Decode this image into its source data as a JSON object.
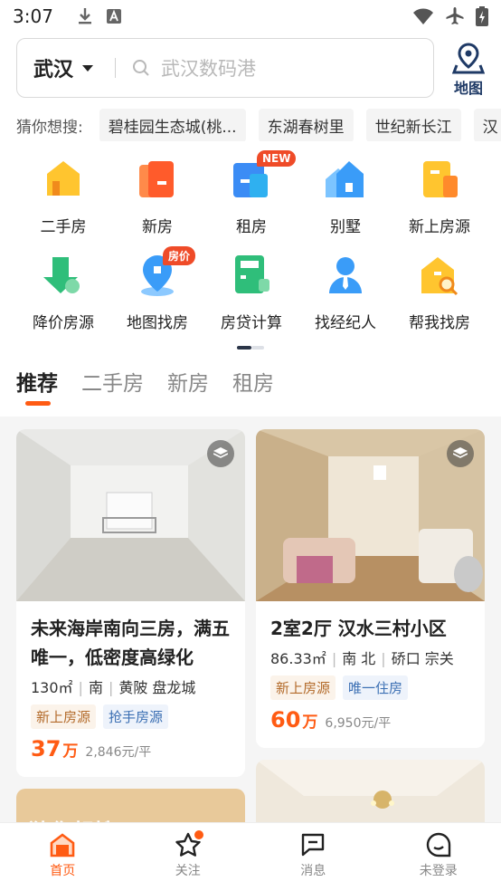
{
  "status_bar": {
    "time": "3:07"
  },
  "search": {
    "city": "武汉",
    "placeholder": "武汉数码港",
    "map_label": "地图"
  },
  "guess": {
    "title": "猜你想搜:",
    "chips": [
      "碧桂园生态城(桃...",
      "东湖春树里",
      "世纪新长江",
      "汉"
    ]
  },
  "grid": [
    [
      {
        "label": "二手房",
        "icon": "second-hand-house-icon",
        "color": "#ffc52f"
      },
      {
        "label": "新房",
        "icon": "new-house-icon",
        "color": "#ff6a3d"
      },
      {
        "label": "租房",
        "icon": "rent-house-icon",
        "color": "#3b8cf5",
        "badge": "NEW"
      },
      {
        "label": "别墅",
        "icon": "villa-icon",
        "color": "#3a9cf8"
      },
      {
        "label": "新上房源",
        "icon": "new-listing-icon",
        "color": "#ffc52f"
      }
    ],
    [
      {
        "label": "降价房源",
        "icon": "price-drop-icon",
        "color": "#2fbe7a"
      },
      {
        "label": "地图找房",
        "icon": "map-search-icon",
        "color": "#3a9cf8",
        "badge": "房价"
      },
      {
        "label": "房贷计算",
        "icon": "mortgage-calculator-icon",
        "color": "#2fbe7a"
      },
      {
        "label": "找经纪人",
        "icon": "agent-icon",
        "color": "#3a9cf8"
      },
      {
        "label": "帮我找房",
        "icon": "help-find-house-icon",
        "color": "#ffc52f"
      }
    ]
  ],
  "tabs": [
    "推荐",
    "二手房",
    "新房",
    "租房"
  ],
  "listings": [
    {
      "title": "未来海岸南向三房，满五唯一，低密度高绿化",
      "area": "130㎡",
      "direction": "南",
      "district": "黄陂 盘龙城",
      "tags": [
        "新上房源",
        "抢手房源"
      ],
      "price": "37",
      "unit": "万",
      "unit_price": "2,846元/平"
    },
    {
      "title": "2室2厅 汉水三村小区",
      "area": "86.33㎡",
      "direction": "南 北",
      "district": "硚口 宗关",
      "tags": [
        "新上房源",
        "唯一住房"
      ],
      "price": "60",
      "unit": "万",
      "unit_price": "6,950元/平"
    }
  ],
  "partial_card_text": "猜你想搜",
  "tabbar": [
    {
      "label": "首页",
      "icon": "home-icon"
    },
    {
      "label": "关注",
      "icon": "star-icon"
    },
    {
      "label": "消息",
      "icon": "message-icon"
    },
    {
      "label": "未登录",
      "icon": "profile-icon"
    }
  ],
  "colors": {
    "accent": "#ff5b13",
    "tag_orange": "#b36b2b",
    "tag_blue": "#3b6fb3"
  }
}
